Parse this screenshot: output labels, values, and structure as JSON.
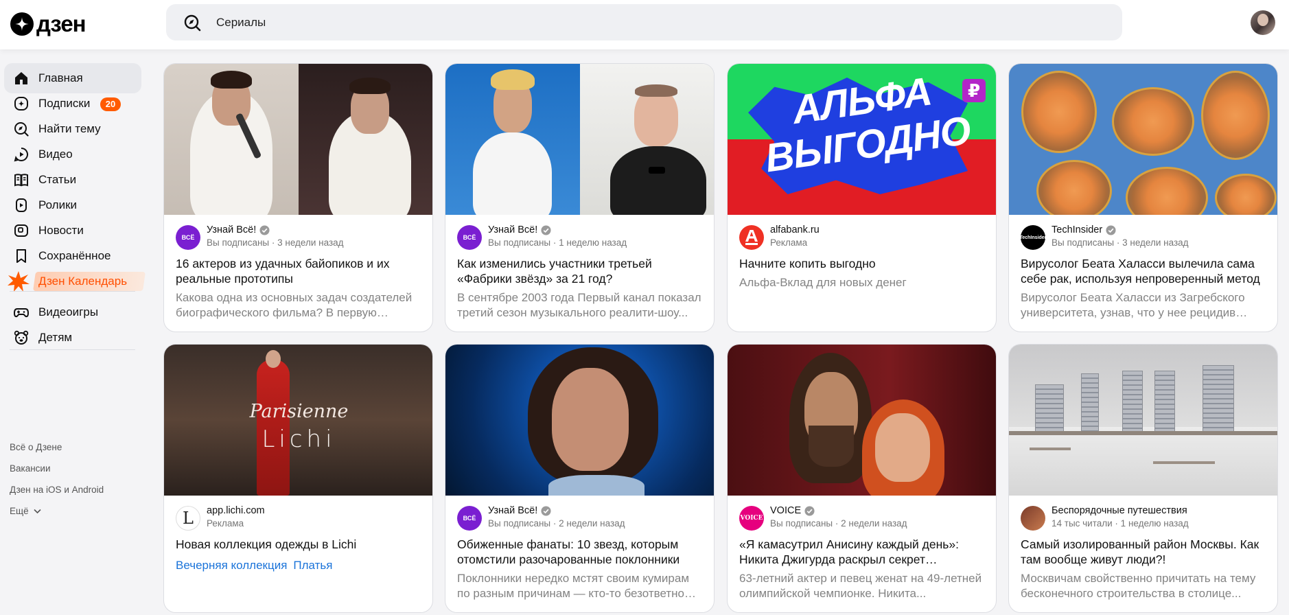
{
  "header": {
    "logo_text": "дзен",
    "search_text": "Сериалы"
  },
  "sidebar": {
    "items": [
      {
        "label": "Главная",
        "icon": "home-icon"
      },
      {
        "label": "Подписки",
        "icon": "subscriptions-icon",
        "badge": "20"
      },
      {
        "label": "Найти тему",
        "icon": "compass-icon"
      },
      {
        "label": "Видео",
        "icon": "video-icon"
      },
      {
        "label": "Статьи",
        "icon": "articles-icon"
      },
      {
        "label": "Ролики",
        "icon": "shorts-icon"
      },
      {
        "label": "Новости",
        "icon": "news-icon"
      },
      {
        "label": "Сохранённое",
        "icon": "bookmark-icon"
      },
      {
        "label": "Дзен Календарь",
        "icon": "calendar-burst-icon"
      }
    ],
    "items2": [
      {
        "label": "Видеоигры",
        "icon": "gamepad-icon"
      },
      {
        "label": "Детям",
        "icon": "kids-bear-icon"
      }
    ],
    "footer": [
      "Всё о Дзене",
      "Вакансии",
      "Дзен на iOS и Android",
      "Ещё"
    ]
  },
  "cards": [
    {
      "source": "Узнай Всё!",
      "meta": "Вы подписаны · 3 недели назад",
      "title": "16 актеров из удачных байопиков и их реальные прототипы",
      "desc": "Какова одна из основных задач создателей биографического фильма? В первую очередь — передать зрителю образ..."
    },
    {
      "source": "Узнай Всё!",
      "meta": "Вы подписаны · 1 неделю назад",
      "title": "Как изменились участники третьей «Фабрики звёзд» за 21 год?",
      "desc": "В сентябре 2003 года Первый канал показал третий сезон музыкального реалити-шоу..."
    },
    {
      "source": "alfabank.ru",
      "meta": "Реклама",
      "title": "Начните копить выгодно",
      "desc": "Альфа-Вклад для новых денег",
      "image_text": [
        "АЛЬФА",
        "ВЫГОДНО"
      ]
    },
    {
      "source": "TechInsider",
      "meta": "Вы подписаны · 3 недели назад",
      "title": "Вирусолог Беата Халасси вылечила сама себе рак, используя непроверенный метод",
      "desc": "Вирусолог Беата Халасси из Загребского университета, узнав, что у нее рецидив рака..."
    },
    {
      "source": "app.lichi.com",
      "meta": "Реклама",
      "title": "Новая коллекция одежды в Lichi",
      "tags": [
        "Вечерняя коллекция",
        "Платья"
      ],
      "image_text": [
        "Parisienne",
        "Lichi"
      ]
    },
    {
      "source": "Узнай Всё!",
      "meta": "Вы подписаны · 2 недели назад",
      "title": "Обиженные фанаты: 10 звезд, которым отомстили разочарованные поклонники",
      "desc": "Поклонники нередко мстят своим кумирам по разным причинам — кто-то безответно влюблен..."
    },
    {
      "source": "VOICE",
      "meta": "Вы подписаны · 2 недели назад",
      "title": "«Я камасутрил Анисину каждый день»: Никита Джигурда раскрыл секрет семейного счастья",
      "desc": "63-летний актер и певец женат на 49-летней олимпийской чемпионке. Никита..."
    },
    {
      "source": "Беспорядочные путешествия",
      "meta": "14 тыс читали · 1 неделю назад",
      "title": "Самый изолированный район Москвы. Как там вообще живут люди?!",
      "desc": "Москвичам свойственно причитать на тему бесконечного строительства в столице..."
    }
  ],
  "colors": {
    "accent": "#ff5b00",
    "link": "#1a73d9",
    "alfa_red": "#e11d24",
    "sidebar_active": "#e7e8ec"
  }
}
